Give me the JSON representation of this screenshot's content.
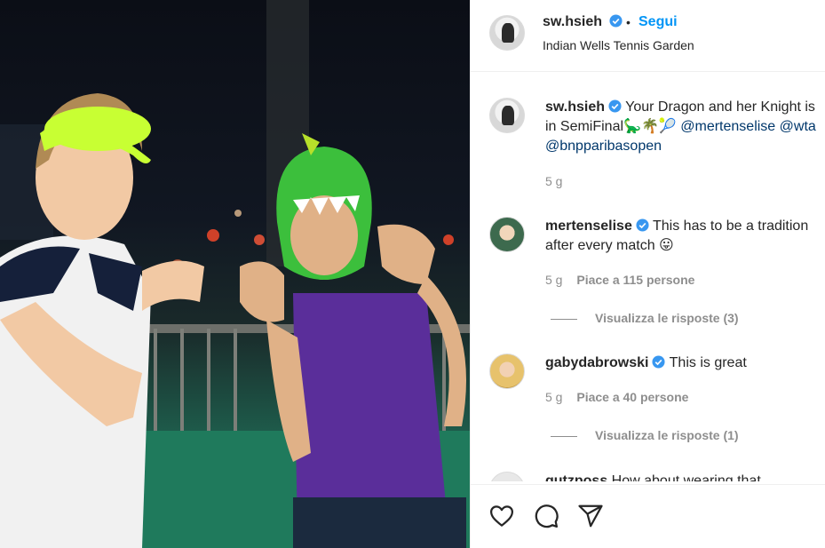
{
  "photo": {
    "description_icon": "photo-content"
  },
  "header": {
    "username": "sw.hsieh",
    "dot": "•",
    "follow_label": "Segui",
    "location": "Indian Wells Tennis Garden"
  },
  "caption": {
    "username": "sw.hsieh",
    "text": "Your Dragon and her Knight is in SemiFinal🦕🌴🎾",
    "mention1": "@mertenselise",
    "mention2": "@wta",
    "mention3": "@bnpparibasopen",
    "time": "5 g"
  },
  "comments": [
    {
      "username": "mertenselise",
      "text": "This has to be a tradition after every match 😛",
      "time": "5 g",
      "likes": "Piace a 115 persone",
      "replies": "Visualizza le risposte (3)"
    },
    {
      "username": "gabydabrowski",
      "text": "This is great",
      "time": "5 g",
      "likes": "Piace a 40 persone",
      "replies": "Visualizza le risposte (1)"
    },
    {
      "username": "gutzposs",
      "text": "How about wearing that"
    }
  ],
  "actions": {
    "like_icon": "heart-icon",
    "comment_icon": "comment-icon",
    "share_icon": "share-icon"
  },
  "colors": {
    "follow": "#0095f6",
    "verified": "#3897f0",
    "meta": "#8e8e8e",
    "mention": "#00376b"
  }
}
